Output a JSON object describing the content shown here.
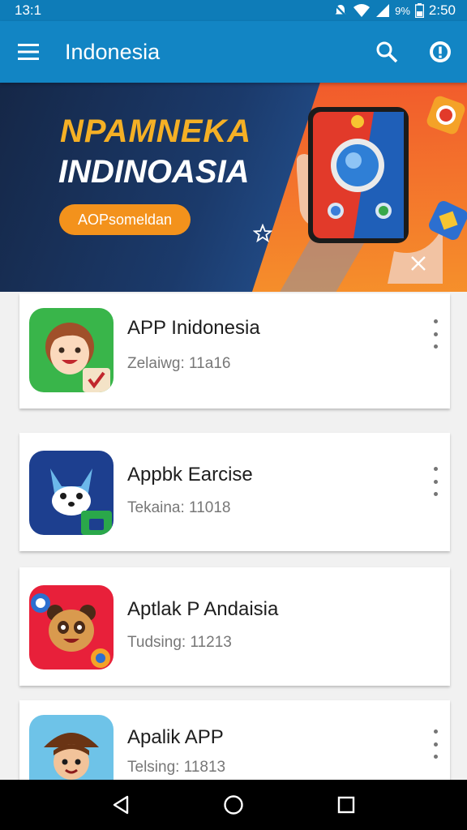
{
  "status_bar": {
    "time_left": "13:1",
    "battery_text": "9%",
    "clock": "2:50"
  },
  "app_bar": {
    "title": "Indonesia",
    "icons": [
      "menu-icon",
      "search-icon",
      "info-icon"
    ]
  },
  "banner": {
    "headline_1": "NPAMNEKA",
    "headline_2": "INDINOASIA",
    "cta_label": "AOPsomeldan",
    "colors": {
      "headline_accent": "#f5b025",
      "cta": "#f3921c"
    }
  },
  "apps": [
    {
      "name": "APP Inidonesia",
      "subtitle": "Zelaiwg: 11a16"
    },
    {
      "name": "Appbk Earcise",
      "subtitle": "Tekaina: 11018"
    },
    {
      "name": "Aptlak P Andaisia",
      "subtitle": "Tudsing: 11213"
    },
    {
      "name": "Apalik APP",
      "subtitle": "Telsing: 11813"
    }
  ],
  "colors": {
    "primary": "#1285c4",
    "status_bar": "#0e7cb8"
  }
}
